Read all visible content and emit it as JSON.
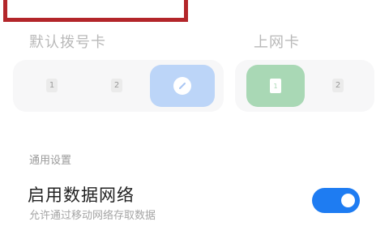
{
  "default_dial": {
    "label": "默认拨号卡",
    "sim1": "1",
    "sim2": "2"
  },
  "mobile_data_sim": {
    "label": "上网卡",
    "sim1": "1",
    "sim2": "2"
  },
  "general_settings": {
    "header": "通用设置",
    "enable_data": {
      "title": "启用数据网络",
      "subtitle": "允许通过移动网络存取数据",
      "enabled": true
    }
  },
  "colors": {
    "accent_blue": "#1e7cf2",
    "selected_blue": "#bcd5f8",
    "selected_green": "#a9d8b5",
    "highlight_red": "#b3262a"
  },
  "icons": {
    "edit": "pencil-edit-icon",
    "sim": "sim-card-icon"
  }
}
